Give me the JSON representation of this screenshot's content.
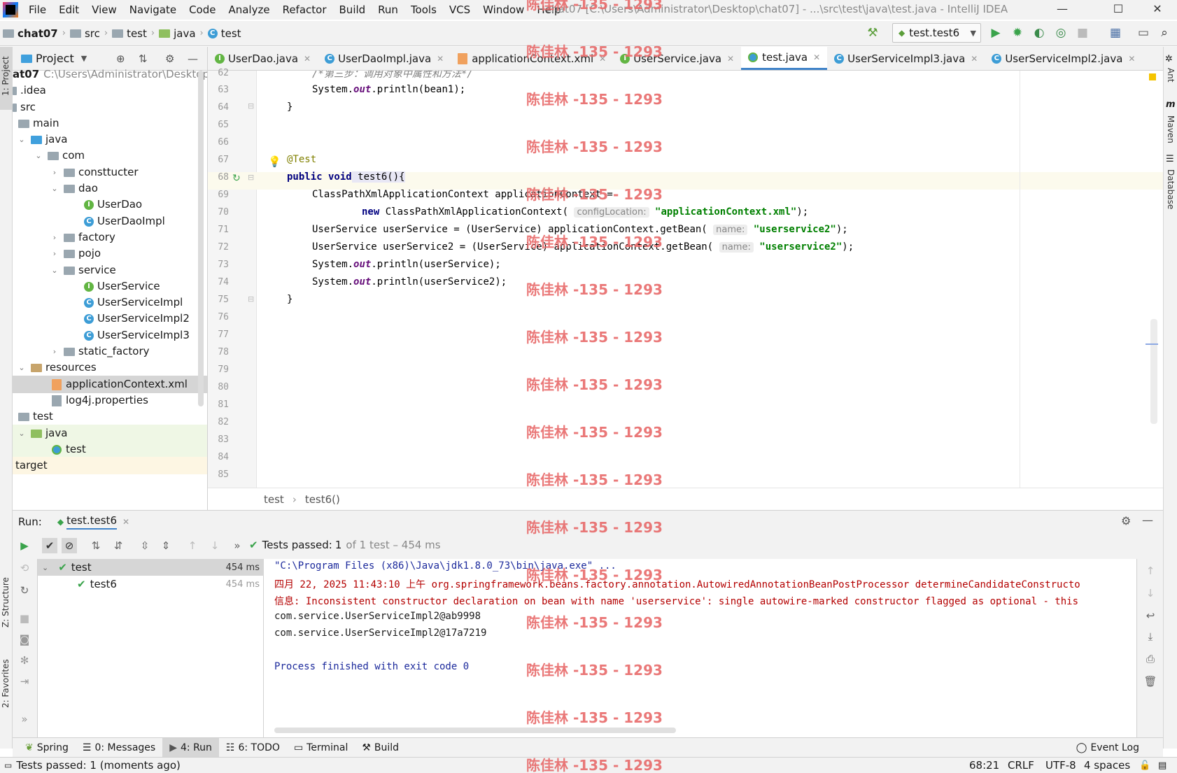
{
  "window": {
    "title": "chat07 [C:\\Users\\Administrator\\Desktop\\chat07] - ...\\src\\test\\java\\test.java - IntelliJ IDEA",
    "controls": [
      "—",
      "☐",
      "✕"
    ]
  },
  "menu": [
    "File",
    "Edit",
    "View",
    "Navigate",
    "Code",
    "Analyze",
    "Refactor",
    "Build",
    "Run",
    "Tools",
    "VCS",
    "Window",
    "Help"
  ],
  "breadcrumb": [
    "chat07",
    "src",
    "test",
    "java",
    "test"
  ],
  "run_config": "test.test6",
  "project_panel": {
    "title": "Project",
    "tree": [
      {
        "label": "at07",
        "extra": "C:\\Users\\Administrator\\Desktop\\",
        "depth": 0
      },
      {
        "label": ".idea",
        "depth": 0
      },
      {
        "label": "src",
        "depth": 0
      },
      {
        "label": "main",
        "depth": 1
      },
      {
        "label": "java",
        "depth": 1
      },
      {
        "label": "com",
        "depth": 2
      },
      {
        "label": "consttucter",
        "depth": 3
      },
      {
        "label": "dao",
        "depth": 3
      },
      {
        "label": "UserDao",
        "depth": 4
      },
      {
        "label": "UserDaoImpl",
        "depth": 4
      },
      {
        "label": "factory",
        "depth": 3
      },
      {
        "label": "pojo",
        "depth": 3
      },
      {
        "label": "service",
        "depth": 3
      },
      {
        "label": "UserService",
        "depth": 4
      },
      {
        "label": "UserServiceImpl",
        "depth": 4
      },
      {
        "label": "UserServiceImpl2",
        "depth": 4
      },
      {
        "label": "UserServiceImpl3",
        "depth": 4
      },
      {
        "label": "static_factory",
        "depth": 3
      },
      {
        "label": "resources",
        "depth": 1
      },
      {
        "label": "applicationContext.xml",
        "depth": 2
      },
      {
        "label": "log4j.properties",
        "depth": 2
      },
      {
        "label": "test",
        "depth": 0
      },
      {
        "label": "java",
        "depth": 1
      },
      {
        "label": "test",
        "depth": 2
      },
      {
        "label": "target",
        "depth": 0
      }
    ]
  },
  "tabs": [
    {
      "label": "UserDao.java",
      "kind": "interface"
    },
    {
      "label": "UserDaoImpl.java",
      "kind": "class"
    },
    {
      "label": "applicationContext.xml",
      "kind": "xml"
    },
    {
      "label": "UserService.java",
      "kind": "interface"
    },
    {
      "label": "test.java",
      "kind": "test",
      "active": true
    },
    {
      "label": "UserServiceImpl3.java",
      "kind": "class"
    },
    {
      "label": "UserServiceImpl2.java",
      "kind": "class"
    }
  ],
  "editor": {
    "line_numbers": [
      "62",
      "63",
      "64",
      "65",
      "66",
      "67",
      "68",
      "69",
      "70",
      "71",
      "72",
      "73",
      "74",
      "75",
      "76",
      "77",
      "78",
      "79",
      "80",
      "81",
      "82",
      "83",
      "84",
      "85"
    ],
    "code": {
      "l62": "/*第三步：调用对象中属性和方法*/",
      "l63a": "System.",
      "l63b": "out",
      "l63c": ".println(bean1);",
      "l64": "}",
      "l67": "@Test",
      "l68a": "public void",
      "l68b": " test6(){",
      "l69": "ClassPathXmlApplicationContext applicationContext =",
      "l70a": "new",
      "l70b": " ClassPathXmlApplicationContext(",
      "l70hint": "configLocation:",
      "l70str": "\"applicationContext.xml\"",
      "l70end": ");",
      "l71a": "UserService userService = (UserService) applicationContext.getBean(",
      "l71hint": "name:",
      "l71str": "\"userservice2\"",
      "l71end": ");",
      "l72a": "UserService userService2 = (UserService) applicationContext.getBean(",
      "l72hint": "name:",
      "l72str": "\"userservice2\"",
      "l72end": ");",
      "l73a": "System.",
      "l73b": "out",
      "l73c": ".println(userService);",
      "l74a": "System.",
      "l74b": "out",
      "l74c": ".println(userService2);",
      "l75": "}"
    },
    "breadcrumb": [
      "test",
      "test6()"
    ]
  },
  "run": {
    "label": "Run:",
    "tab": "test.test6",
    "status_prefix": "Tests passed:",
    "status_count": "1",
    "status_suffix": "of 1 test – 454 ms",
    "tests": [
      {
        "name": "test",
        "time": "454 ms"
      },
      {
        "name": "test6",
        "time": "454 ms"
      }
    ],
    "console": [
      "\"C:\\Program Files (x86)\\Java\\jdk1.8.0_73\\bin\\java.exe\" ...",
      "四月 22, 2025 11:43:10 上午 org.springframework.beans.factory.annotation.AutowiredAnnotationBeanPostProcessor determineCandidateConstructo",
      "信息: Inconsistent constructor declaration on bean with name 'userservice': single autowire-marked constructor flagged as optional - this",
      "com.service.UserServiceImpl2@ab9998",
      "com.service.UserServiceImpl2@17a7219",
      "",
      "Process finished with exit code 0"
    ]
  },
  "bottom_tools": [
    "Spring",
    "0: Messages",
    "4: Run",
    "6: TODO",
    "Terminal",
    "Build"
  ],
  "event_log": "Event Log",
  "status": {
    "message": "Tests passed: 1 (moments ago)",
    "position": "68:21",
    "line_sep": "CRLF",
    "encoding": "UTF-8",
    "indent": "4 spaces"
  },
  "side_labels": {
    "left": [
      "1: Project",
      "Z: Structure",
      "2: Favorites"
    ],
    "right": [
      "Ant",
      "Maven",
      "Database"
    ]
  },
  "watermark": "陈佳林 -135 - 1293"
}
